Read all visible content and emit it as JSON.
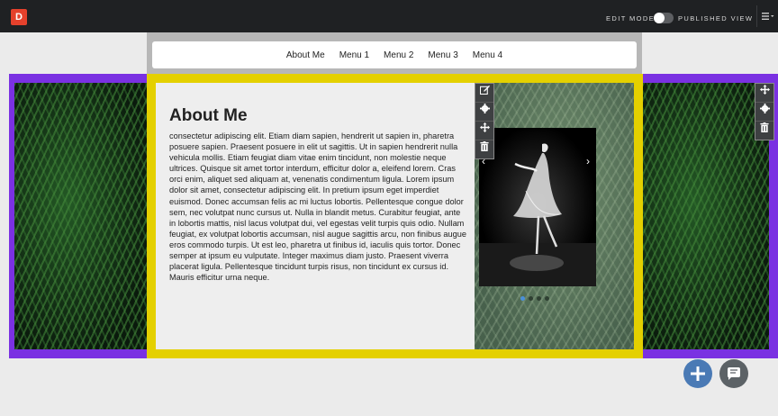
{
  "app": {
    "logo_letter": "D"
  },
  "topbar": {
    "edit_mode_label": "EDIT MODE",
    "published_view_label": "PUBLISHED VIEW",
    "menu_icon": "hamburger-menu-icon"
  },
  "nav": {
    "items": [
      "About Me",
      "Menu 1",
      "Menu 2",
      "Menu 3",
      "Menu 4"
    ]
  },
  "content": {
    "heading": "About Me",
    "body": "consectetur adipiscing elit. Etiam diam sapien, hendrerit ut sapien in, pharetra posuere sapien. Praesent posuere in elit ut sagittis. Ut in sapien hendrerit nulla vehicula mollis. Etiam feugiat diam vitae enim tincidunt, non molestie neque ultrices. Quisque sit amet tortor interdum, efficitur dolor a, eleifend lorem. Cras orci enim, aliquet sed aliquam at, venenatis condimentum ligula. Lorem ipsum dolor sit amet, consectetur adipiscing elit. In pretium ipsum eget imperdiet euismod. Donec accumsan felis ac mi luctus lobortis. Pellentesque congue dolor sem, nec volutpat nunc cursus ut. Nulla in blandit metus. Curabitur feugiat, ante in lobortis mattis, nisl lacus volutpat dui, vel egestas velit turpis quis odio. Nullam feugiat, ex volutpat lobortis accumsan, nisl augue sagittis arcu, non finibus augue eros commodo turpis. Ut est leo, pharetra ut finibus id, iaculis quis tortor. Donec semper at ipsum eu vulputate. Integer maximus diam justo. Praesent viverra placerat ligula. Pellentesque tincidunt turpis risus, non tincidunt ex cursus id. Mauris efficitur urna neque."
  },
  "column_tools": [
    "edit-icon",
    "gear-icon",
    "move-icon",
    "trash-icon"
  ],
  "row_tools": [
    "move-icon",
    "gear-icon",
    "trash-icon"
  ],
  "slideshow": {
    "prev_arrow": "‹",
    "next_arrow": "›",
    "dot_count": 4,
    "active_dot": 0
  },
  "fabs": [
    "add-icon",
    "chat-icon"
  ],
  "colors": {
    "topbar": "#1f2123",
    "logo": "#e5412c",
    "row_outline": "#7a31e2",
    "container_outline": "#e4d000",
    "add_button": "#4a7ab5",
    "chat_button": "#5c6266"
  }
}
